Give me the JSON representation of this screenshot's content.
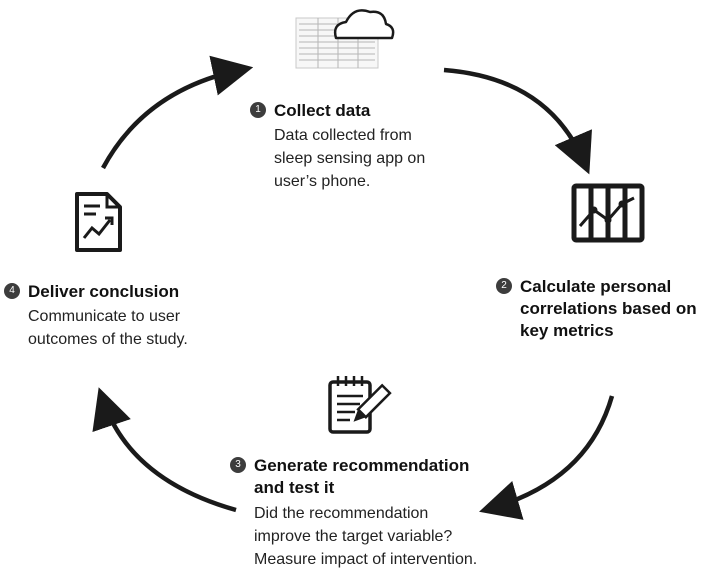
{
  "steps": [
    {
      "number": "1",
      "title_lines": [
        "Collect data"
      ],
      "desc_lines": [
        "Data collected from",
        "sleep sensing app on",
        "user’s phone."
      ],
      "icon": "cloud-data-icon"
    },
    {
      "number": "2",
      "title_lines": [
        "Calculate personal",
        "correlations based on",
        "key metrics"
      ],
      "desc_lines": [],
      "icon": "chart-grid-icon"
    },
    {
      "number": "3",
      "title_lines": [
        "Generate recommendation",
        "and test it"
      ],
      "desc_lines": [
        "Did the recommendation",
        "improve the target variable?",
        "Measure impact of intervention."
      ],
      "icon": "notepad-pencil-icon"
    },
    {
      "number": "4",
      "title_lines": [
        "Deliver conclusion"
      ],
      "desc_lines": [
        "Communicate to user",
        "outcomes of the study."
      ],
      "icon": "report-document-icon"
    }
  ],
  "colors": {
    "ink": "#1a1a1a",
    "badge": "#3d3d3d"
  }
}
